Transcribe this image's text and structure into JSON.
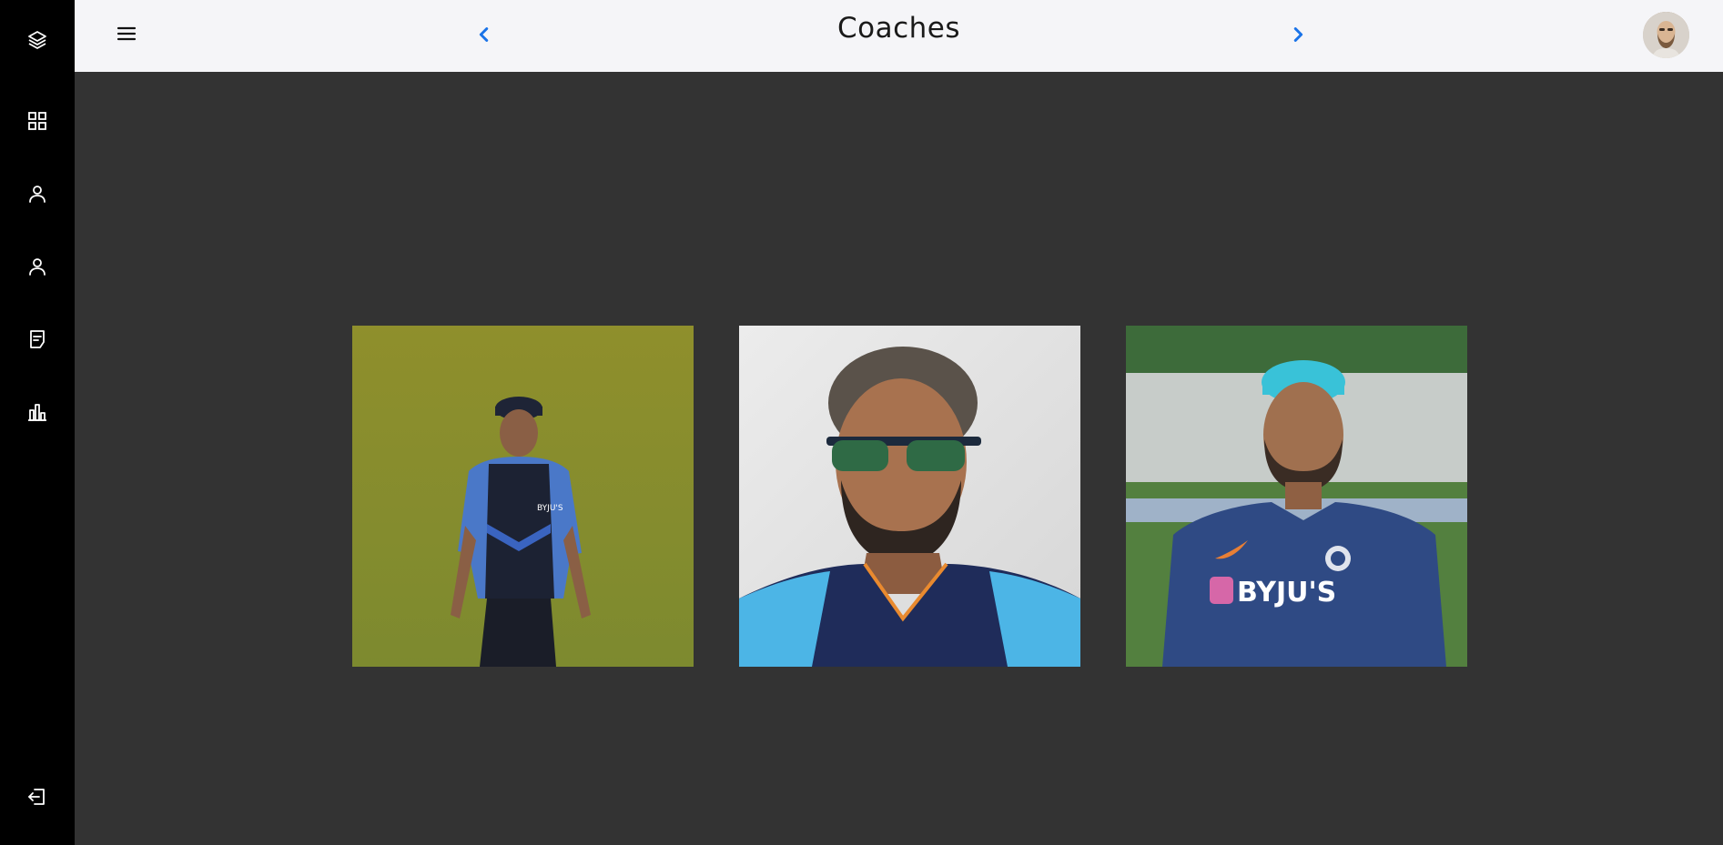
{
  "sidebar": {
    "items": [
      {
        "icon": "layers-icon"
      },
      {
        "icon": "dashboard-grid-icon"
      },
      {
        "icon": "user-icon"
      },
      {
        "icon": "user-icon"
      },
      {
        "icon": "notes-icon"
      },
      {
        "icon": "bar-chart-icon"
      }
    ],
    "logout_icon": "logout-icon"
  },
  "header": {
    "title": "Coaches",
    "menu_icon": "hamburger-menu-icon",
    "prev_icon": "chevron-left-icon",
    "next_icon": "chevron-right-icon",
    "avatar": "user-avatar"
  },
  "main": {
    "coaches": [
      {
        "photo": "coach-photo",
        "caption_text": "BYJU'S"
      },
      {
        "photo": "coach-photo"
      },
      {
        "photo": "coach-photo",
        "jersey_text": "BYJU'S"
      }
    ]
  },
  "colors": {
    "sidebar_bg": "#000000",
    "header_bg": "#f5f5f8",
    "content_bg": "#333333",
    "accent": "#1a73e8",
    "icon": "#ffffff"
  }
}
